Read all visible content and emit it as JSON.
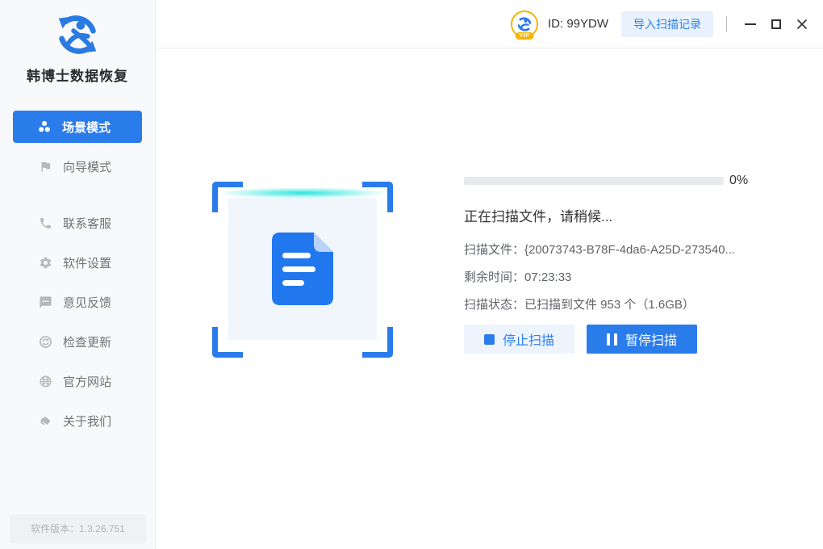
{
  "colors": {
    "accent": "#2b7ceb",
    "accent_light_bg": "#eef4fd",
    "scan_line": "#24e4dc",
    "vip_gold": "#f7b500",
    "sidebar_bg": "#f8f9fa"
  },
  "app": {
    "name": "韩博士数据恢复",
    "logo_icon": "recovery-logo-icon",
    "version": "软件版本：1.3.26.751"
  },
  "titlebar": {
    "vip_badge": "VIP",
    "user_id": "ID: 99YDW",
    "import_button": "导入扫描记录",
    "window_icons": [
      "minimize-icon",
      "maximize-icon",
      "close-icon"
    ]
  },
  "sidebar": {
    "items": [
      {
        "label": "场景模式",
        "icon": "scene-mode-icon",
        "active": true
      },
      {
        "label": "向导模式",
        "icon": "wizard-flag-icon",
        "active": false
      },
      {
        "label": "联系客服",
        "icon": "phone-icon",
        "active": false
      },
      {
        "label": "软件设置",
        "icon": "gear-icon",
        "active": false
      },
      {
        "label": "意见反馈",
        "icon": "feedback-bubble-icon",
        "active": false
      },
      {
        "label": "检查更新",
        "icon": "update-icon",
        "active": false
      },
      {
        "label": "官方网站",
        "icon": "globe-icon",
        "active": false
      },
      {
        "label": "关于我们",
        "icon": "handshake-icon",
        "active": false
      }
    ]
  },
  "main": {
    "scan_animation": {
      "icon": "document-icon",
      "frame_icon": "scan-corner-brackets"
    },
    "progress": {
      "value": 0,
      "percent": "0%"
    },
    "status_title": "正在扫描文件，请稍候...",
    "details": [
      {
        "label": "扫描文件：",
        "value": "{20073743-B78F-4da6-A25D-273540..."
      },
      {
        "label": "剩余时间：",
        "value": "07:23:33"
      },
      {
        "label": "扫描状态：",
        "value": "已扫描到文件 953 个（1.6GB）"
      }
    ],
    "buttons": {
      "stop": "停止扫描",
      "pause": "暂停扫描"
    }
  }
}
